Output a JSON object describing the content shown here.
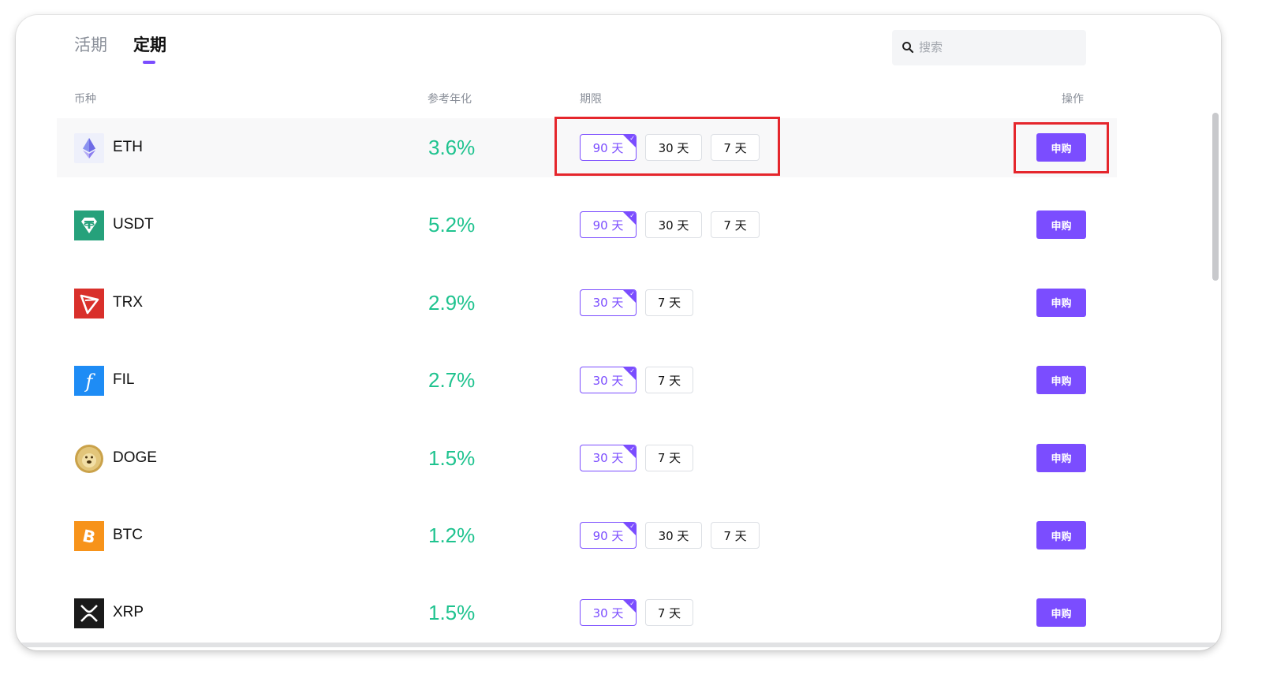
{
  "tabs": [
    {
      "label": "活期",
      "active": false
    },
    {
      "label": "定期",
      "active": true
    }
  ],
  "search": {
    "placeholder": "搜索",
    "value": ""
  },
  "columns": {
    "coin": "币种",
    "apy": "参考年化",
    "term": "期限",
    "action": "操作"
  },
  "action_label": "申购",
  "accent_color": "#7b4dff",
  "apy_color": "#1fc38f",
  "highlight_color": "#e5262c",
  "rows": [
    {
      "coin": "ETH",
      "icon": "eth-icon",
      "apy": "3.6%",
      "terms": [
        "90 天",
        "30 天",
        "7 天"
      ],
      "selected": 0
    },
    {
      "coin": "USDT",
      "icon": "usdt-icon",
      "apy": "5.2%",
      "terms": [
        "90 天",
        "30 天",
        "7 天"
      ],
      "selected": 0
    },
    {
      "coin": "TRX",
      "icon": "trx-icon",
      "apy": "2.9%",
      "terms": [
        "30 天",
        "7 天"
      ],
      "selected": 0
    },
    {
      "coin": "FIL",
      "icon": "fil-icon",
      "apy": "2.7%",
      "terms": [
        "30 天",
        "7 天"
      ],
      "selected": 0
    },
    {
      "coin": "DOGE",
      "icon": "doge-icon",
      "apy": "1.5%",
      "terms": [
        "30 天",
        "7 天"
      ],
      "selected": 0
    },
    {
      "coin": "BTC",
      "icon": "btc-icon",
      "apy": "1.2%",
      "terms": [
        "90 天",
        "30 天",
        "7 天"
      ],
      "selected": 0
    },
    {
      "coin": "XRP",
      "icon": "xrp-icon",
      "apy": "1.5%",
      "terms": [
        "30 天",
        "7 天"
      ],
      "selected": 0
    }
  ]
}
